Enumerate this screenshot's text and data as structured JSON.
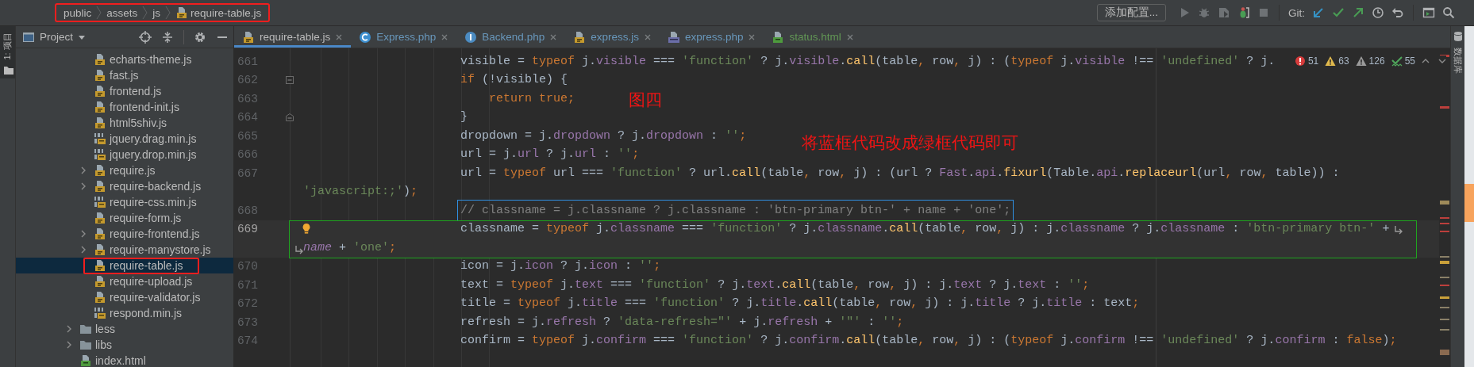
{
  "breadcrumb": {
    "boxed": true,
    "items": [
      {
        "label": "public",
        "kind": "folder"
      },
      {
        "label": "assets",
        "kind": "folder"
      },
      {
        "label": "js",
        "kind": "folder"
      },
      {
        "label": "require-table.js",
        "kind": "js"
      }
    ]
  },
  "toolbar": {
    "config_button": "添加配置...",
    "git_label": "Git:"
  },
  "left_tool_strip": {
    "label": "1: 项目"
  },
  "right_tool_strip": {
    "label": "数据库"
  },
  "project_panel": {
    "title": "Project",
    "tree": [
      {
        "children": [
          {
            "label": "echarts-theme.js",
            "kind": "js",
            "selected": false
          },
          {
            "label": "fast.js",
            "kind": "js",
            "selected": false
          },
          {
            "label": "frontend.js",
            "kind": "js",
            "selected": false
          },
          {
            "label": "frontend-init.js",
            "kind": "js",
            "selected": false
          },
          {
            "label": "html5shiv.js",
            "kind": "js",
            "selected": false
          },
          {
            "label": "jquery.drag.min.js",
            "kind": "minjs",
            "selected": false
          },
          {
            "label": "jquery.drop.min.js",
            "kind": "minjs",
            "selected": false
          },
          {
            "label": "require.js",
            "kind": "js",
            "selected": false,
            "expanded": false
          },
          {
            "label": "require-backend.js",
            "kind": "js",
            "selected": false,
            "expanded": false
          },
          {
            "label": "require-css.min.js",
            "kind": "minjs",
            "selected": false
          },
          {
            "label": "require-form.js",
            "kind": "js",
            "selected": false
          },
          {
            "label": "require-frontend.js",
            "kind": "js",
            "selected": false,
            "expanded": false
          },
          {
            "label": "require-manystore.js",
            "kind": "js",
            "selected": false,
            "expanded": false
          },
          {
            "label": "require-table.js",
            "kind": "js",
            "selected": true,
            "boxed": true
          },
          {
            "label": "require-upload.js",
            "kind": "js",
            "selected": false
          },
          {
            "label": "require-validator.js",
            "kind": "js",
            "selected": false
          },
          {
            "label": "respond.min.js",
            "kind": "minjs",
            "selected": false
          }
        ]
      },
      {
        "label": "less",
        "kind": "folder",
        "selected": false,
        "expanded": false
      },
      {
        "label": "libs",
        "kind": "folder",
        "selected": false,
        "expanded": false
      },
      {
        "label": "index.html",
        "kind": "html",
        "selected": false
      }
    ]
  },
  "tabs": [
    {
      "label": "require-table.js",
      "kind": "js",
      "color": "#bbbbbb",
      "selected": true
    },
    {
      "label": "Express.php",
      "kind": "class",
      "color": "#6897bb",
      "selected": false
    },
    {
      "label": "Backend.php",
      "kind": "interface",
      "color": "#6897bb",
      "selected": false
    },
    {
      "label": "express.js",
      "kind": "js",
      "color": "#6897bb",
      "selected": false
    },
    {
      "label": "express.php",
      "kind": "php",
      "color": "#6897bb",
      "selected": false
    },
    {
      "label": "status.html",
      "kind": "html",
      "color": "#629755",
      "selected": false
    }
  ],
  "inspections": {
    "errors": "51",
    "warnings": "63",
    "weak_warnings": "126",
    "typos": "55"
  },
  "code_lines": [
    {
      "number": "661",
      "kind": "stmt",
      "current": false,
      "tokens": [
        {
          "kind": "plain",
          "text": "visible = "
        },
        {
          "kind": "keyword",
          "text": "typeof"
        },
        {
          "kind": "plain",
          "text": " j."
        },
        {
          "kind": "field",
          "text": "visible"
        },
        {
          "kind": "plain",
          "text": " === "
        },
        {
          "kind": "string",
          "text": "'function'"
        },
        {
          "kind": "plain",
          "text": " ? j."
        },
        {
          "kind": "field",
          "text": "visible"
        },
        {
          "kind": "plain",
          "text": "."
        },
        {
          "kind": "method",
          "text": "call"
        },
        {
          "kind": "plain",
          "text": "(table"
        },
        {
          "kind": "keyword",
          "text": ","
        },
        {
          "kind": "plain",
          "text": " row"
        },
        {
          "kind": "keyword",
          "text": ","
        },
        {
          "kind": "plain",
          "text": " j) : ("
        },
        {
          "kind": "keyword",
          "text": "typeof"
        },
        {
          "kind": "plain",
          "text": " j."
        },
        {
          "kind": "field",
          "text": "visible"
        },
        {
          "kind": "plain",
          "text": " !== "
        },
        {
          "kind": "string",
          "text": "'undefined'"
        },
        {
          "kind": "plain",
          "text": " ? j."
        }
      ]
    },
    {
      "number": "662",
      "kind": "stmt",
      "current": false,
      "fold_start": true,
      "tokens": [
        {
          "kind": "keyword",
          "text": "if"
        },
        {
          "kind": "plain",
          "text": " (!visible) {"
        }
      ]
    },
    {
      "number": "663",
      "kind": "inner",
      "current": false,
      "note": "图四",
      "tokens": [
        {
          "kind": "keyword",
          "text": "return true;"
        }
      ]
    },
    {
      "number": "664",
      "kind": "stmt",
      "current": false,
      "fold_end": true,
      "tokens": [
        {
          "kind": "plain",
          "text": "}"
        }
      ]
    },
    {
      "number": "665",
      "kind": "stmt",
      "current": false,
      "note": "将蓝框代码改成绿框代码即可",
      "tokens": [
        {
          "kind": "plain",
          "text": "dropdown = j."
        },
        {
          "kind": "field",
          "text": "dropdown"
        },
        {
          "kind": "plain",
          "text": " ? j."
        },
        {
          "kind": "field",
          "text": "dropdown"
        },
        {
          "kind": "plain",
          "text": " : "
        },
        {
          "kind": "string",
          "text": "''"
        },
        {
          "kind": "keyword",
          "text": ";"
        }
      ]
    },
    {
      "number": "666",
      "kind": "stmt",
      "current": false,
      "tokens": [
        {
          "kind": "plain",
          "text": "url = j."
        },
        {
          "kind": "field",
          "text": "url"
        },
        {
          "kind": "plain",
          "text": " ? j."
        },
        {
          "kind": "field",
          "text": "url"
        },
        {
          "kind": "plain",
          "text": " : "
        },
        {
          "kind": "string",
          "text": "''"
        },
        {
          "kind": "keyword",
          "text": ";"
        }
      ]
    },
    {
      "number": "667",
      "kind": "stmt",
      "current": false,
      "tokens": [
        {
          "kind": "plain",
          "text": "url = "
        },
        {
          "kind": "keyword",
          "text": "typeof"
        },
        {
          "kind": "plain",
          "text": " url === "
        },
        {
          "kind": "string",
          "text": "'function'"
        },
        {
          "kind": "plain",
          "text": " ? url."
        },
        {
          "kind": "method",
          "text": "call"
        },
        {
          "kind": "plain",
          "text": "(table"
        },
        {
          "kind": "keyword",
          "text": ","
        },
        {
          "kind": "plain",
          "text": " row"
        },
        {
          "kind": "keyword",
          "text": ","
        },
        {
          "kind": "plain",
          "text": " j) : (url ? "
        },
        {
          "kind": "field",
          "text": "Fast"
        },
        {
          "kind": "plain",
          "text": "."
        },
        {
          "kind": "field",
          "text": "api"
        },
        {
          "kind": "plain",
          "text": "."
        },
        {
          "kind": "method",
          "text": "fixurl"
        },
        {
          "kind": "plain",
          "text": "(Table."
        },
        {
          "kind": "field",
          "text": "api"
        },
        {
          "kind": "plain",
          "text": "."
        },
        {
          "kind": "method",
          "text": "replaceurl"
        },
        {
          "kind": "plain",
          "text": "(url"
        },
        {
          "kind": "keyword",
          "text": ","
        },
        {
          "kind": "plain",
          "text": " row"
        },
        {
          "kind": "keyword",
          "text": ","
        },
        {
          "kind": "plain",
          "text": " table)) :"
        }
      ],
      "wrap": [
        {
          "kind": "string",
          "text": "'javascript:;'"
        },
        {
          "kind": "plain",
          "text": ")"
        },
        {
          "kind": "keyword",
          "text": ";"
        }
      ]
    },
    {
      "number": "668",
      "kind": "stmt",
      "current": false,
      "framed": true,
      "color": "#2f8fe0",
      "tokens": [
        {
          "kind": "comment",
          "text": "// classname = j.classname ? j.classname : 'btn-primary btn-' + name + 'one';"
        }
      ]
    },
    {
      "number": "669",
      "kind": "stmt",
      "current": true,
      "framed": true,
      "color": "#1fa51f",
      "bulb": true,
      "tokens": [
        {
          "kind": "plain",
          "text": "classname = "
        },
        {
          "kind": "keyword",
          "text": "typeof"
        },
        {
          "kind": "plain",
          "text": " j."
        },
        {
          "kind": "field",
          "text": "classname"
        },
        {
          "kind": "plain",
          "text": " === "
        },
        {
          "kind": "string",
          "text": "'function'"
        },
        {
          "kind": "plain",
          "text": " ? j."
        },
        {
          "kind": "field",
          "text": "classname"
        },
        {
          "kind": "plain",
          "text": "."
        },
        {
          "kind": "method",
          "text": "call"
        },
        {
          "kind": "plain",
          "text": "(table"
        },
        {
          "kind": "keyword",
          "text": ","
        },
        {
          "kind": "plain",
          "text": " row"
        },
        {
          "kind": "keyword",
          "text": ","
        },
        {
          "kind": "plain",
          "text": " j) : j."
        },
        {
          "kind": "field",
          "text": "classname"
        },
        {
          "kind": "plain",
          "text": " ? j."
        },
        {
          "kind": "field",
          "text": "classname"
        },
        {
          "kind": "plain",
          "text": " : "
        },
        {
          "kind": "string",
          "text": "'btn-primary btn-'"
        },
        {
          "kind": "plain",
          "text": " +"
        }
      ],
      "wrap": [
        {
          "kind": "global",
          "text": "name"
        },
        {
          "kind": "plain",
          "text": " + "
        },
        {
          "kind": "string",
          "text": "'one'"
        },
        {
          "kind": "keyword",
          "text": ";"
        }
      ]
    },
    {
      "number": "670",
      "kind": "stmt",
      "current": false,
      "tokens": [
        {
          "kind": "plain",
          "text": "icon = j."
        },
        {
          "kind": "field",
          "text": "icon"
        },
        {
          "kind": "plain",
          "text": " ? j."
        },
        {
          "kind": "field",
          "text": "icon"
        },
        {
          "kind": "plain",
          "text": " : "
        },
        {
          "kind": "string",
          "text": "''"
        },
        {
          "kind": "keyword",
          "text": ";"
        }
      ]
    },
    {
      "number": "671",
      "kind": "stmt",
      "current": false,
      "tokens": [
        {
          "kind": "plain",
          "text": "text = "
        },
        {
          "kind": "keyword",
          "text": "typeof"
        },
        {
          "kind": "plain",
          "text": " j."
        },
        {
          "kind": "field",
          "text": "text"
        },
        {
          "kind": "plain",
          "text": " === "
        },
        {
          "kind": "string",
          "text": "'function'"
        },
        {
          "kind": "plain",
          "text": " ? j."
        },
        {
          "kind": "field",
          "text": "text"
        },
        {
          "kind": "plain",
          "text": "."
        },
        {
          "kind": "method",
          "text": "call"
        },
        {
          "kind": "plain",
          "text": "(table"
        },
        {
          "kind": "keyword",
          "text": ","
        },
        {
          "kind": "plain",
          "text": " row"
        },
        {
          "kind": "keyword",
          "text": ","
        },
        {
          "kind": "plain",
          "text": " j) : j."
        },
        {
          "kind": "field",
          "text": "text"
        },
        {
          "kind": "plain",
          "text": " ? j."
        },
        {
          "kind": "field",
          "text": "text"
        },
        {
          "kind": "plain",
          "text": " : "
        },
        {
          "kind": "string",
          "text": "''"
        },
        {
          "kind": "keyword",
          "text": ";"
        }
      ]
    },
    {
      "number": "672",
      "kind": "stmt",
      "current": false,
      "tokens": [
        {
          "kind": "plain",
          "text": "title = "
        },
        {
          "kind": "keyword",
          "text": "typeof"
        },
        {
          "kind": "plain",
          "text": " j."
        },
        {
          "kind": "field",
          "text": "title"
        },
        {
          "kind": "plain",
          "text": " === "
        },
        {
          "kind": "string",
          "text": "'function'"
        },
        {
          "kind": "plain",
          "text": " ? j."
        },
        {
          "kind": "field",
          "text": "title"
        },
        {
          "kind": "plain",
          "text": "."
        },
        {
          "kind": "method",
          "text": "call"
        },
        {
          "kind": "plain",
          "text": "(table"
        },
        {
          "kind": "keyword",
          "text": ","
        },
        {
          "kind": "plain",
          "text": " row"
        },
        {
          "kind": "keyword",
          "text": ","
        },
        {
          "kind": "plain",
          "text": " j) : j."
        },
        {
          "kind": "field",
          "text": "title"
        },
        {
          "kind": "plain",
          "text": " ? j."
        },
        {
          "kind": "field",
          "text": "title"
        },
        {
          "kind": "plain",
          "text": " : text"
        },
        {
          "kind": "keyword",
          "text": ";"
        }
      ]
    },
    {
      "number": "673",
      "kind": "stmt",
      "current": false,
      "tokens": [
        {
          "kind": "plain",
          "text": "refresh = j."
        },
        {
          "kind": "field",
          "text": "refresh"
        },
        {
          "kind": "plain",
          "text": " ? "
        },
        {
          "kind": "string",
          "text": "'data-refresh=\"'"
        },
        {
          "kind": "plain",
          "text": " + j."
        },
        {
          "kind": "field",
          "text": "refresh"
        },
        {
          "kind": "plain",
          "text": " + "
        },
        {
          "kind": "string",
          "text": "'\"'"
        },
        {
          "kind": "plain",
          "text": " : "
        },
        {
          "kind": "string",
          "text": "''"
        },
        {
          "kind": "keyword",
          "text": ";"
        }
      ]
    },
    {
      "number": "674",
      "kind": "stmt",
      "current": false,
      "tokens": [
        {
          "kind": "plain",
          "text": "confirm = "
        },
        {
          "kind": "keyword",
          "text": "typeof"
        },
        {
          "kind": "plain",
          "text": " j."
        },
        {
          "kind": "field",
          "text": "confirm"
        },
        {
          "kind": "plain",
          "text": " === "
        },
        {
          "kind": "string",
          "text": "'function'"
        },
        {
          "kind": "plain",
          "text": " ? j."
        },
        {
          "kind": "field",
          "text": "confirm"
        },
        {
          "kind": "plain",
          "text": "."
        },
        {
          "kind": "method",
          "text": "call"
        },
        {
          "kind": "plain",
          "text": "(table"
        },
        {
          "kind": "keyword",
          "text": ","
        },
        {
          "kind": "plain",
          "text": " row"
        },
        {
          "kind": "keyword",
          "text": ","
        },
        {
          "kind": "plain",
          "text": " j) : ("
        },
        {
          "kind": "keyword",
          "text": "typeof"
        },
        {
          "kind": "plain",
          "text": " j."
        },
        {
          "kind": "field",
          "text": "confirm"
        },
        {
          "kind": "plain",
          "text": " !== "
        },
        {
          "kind": "string",
          "text": "'undefined'"
        },
        {
          "kind": "plain",
          "text": " ? j."
        },
        {
          "kind": "field",
          "text": "confirm"
        },
        {
          "kind": "plain",
          "text": " : "
        },
        {
          "kind": "keyword",
          "text": "false"
        },
        {
          "kind": "plain",
          "text": ")"
        },
        {
          "kind": "keyword",
          "text": ";"
        }
      ]
    }
  ]
}
